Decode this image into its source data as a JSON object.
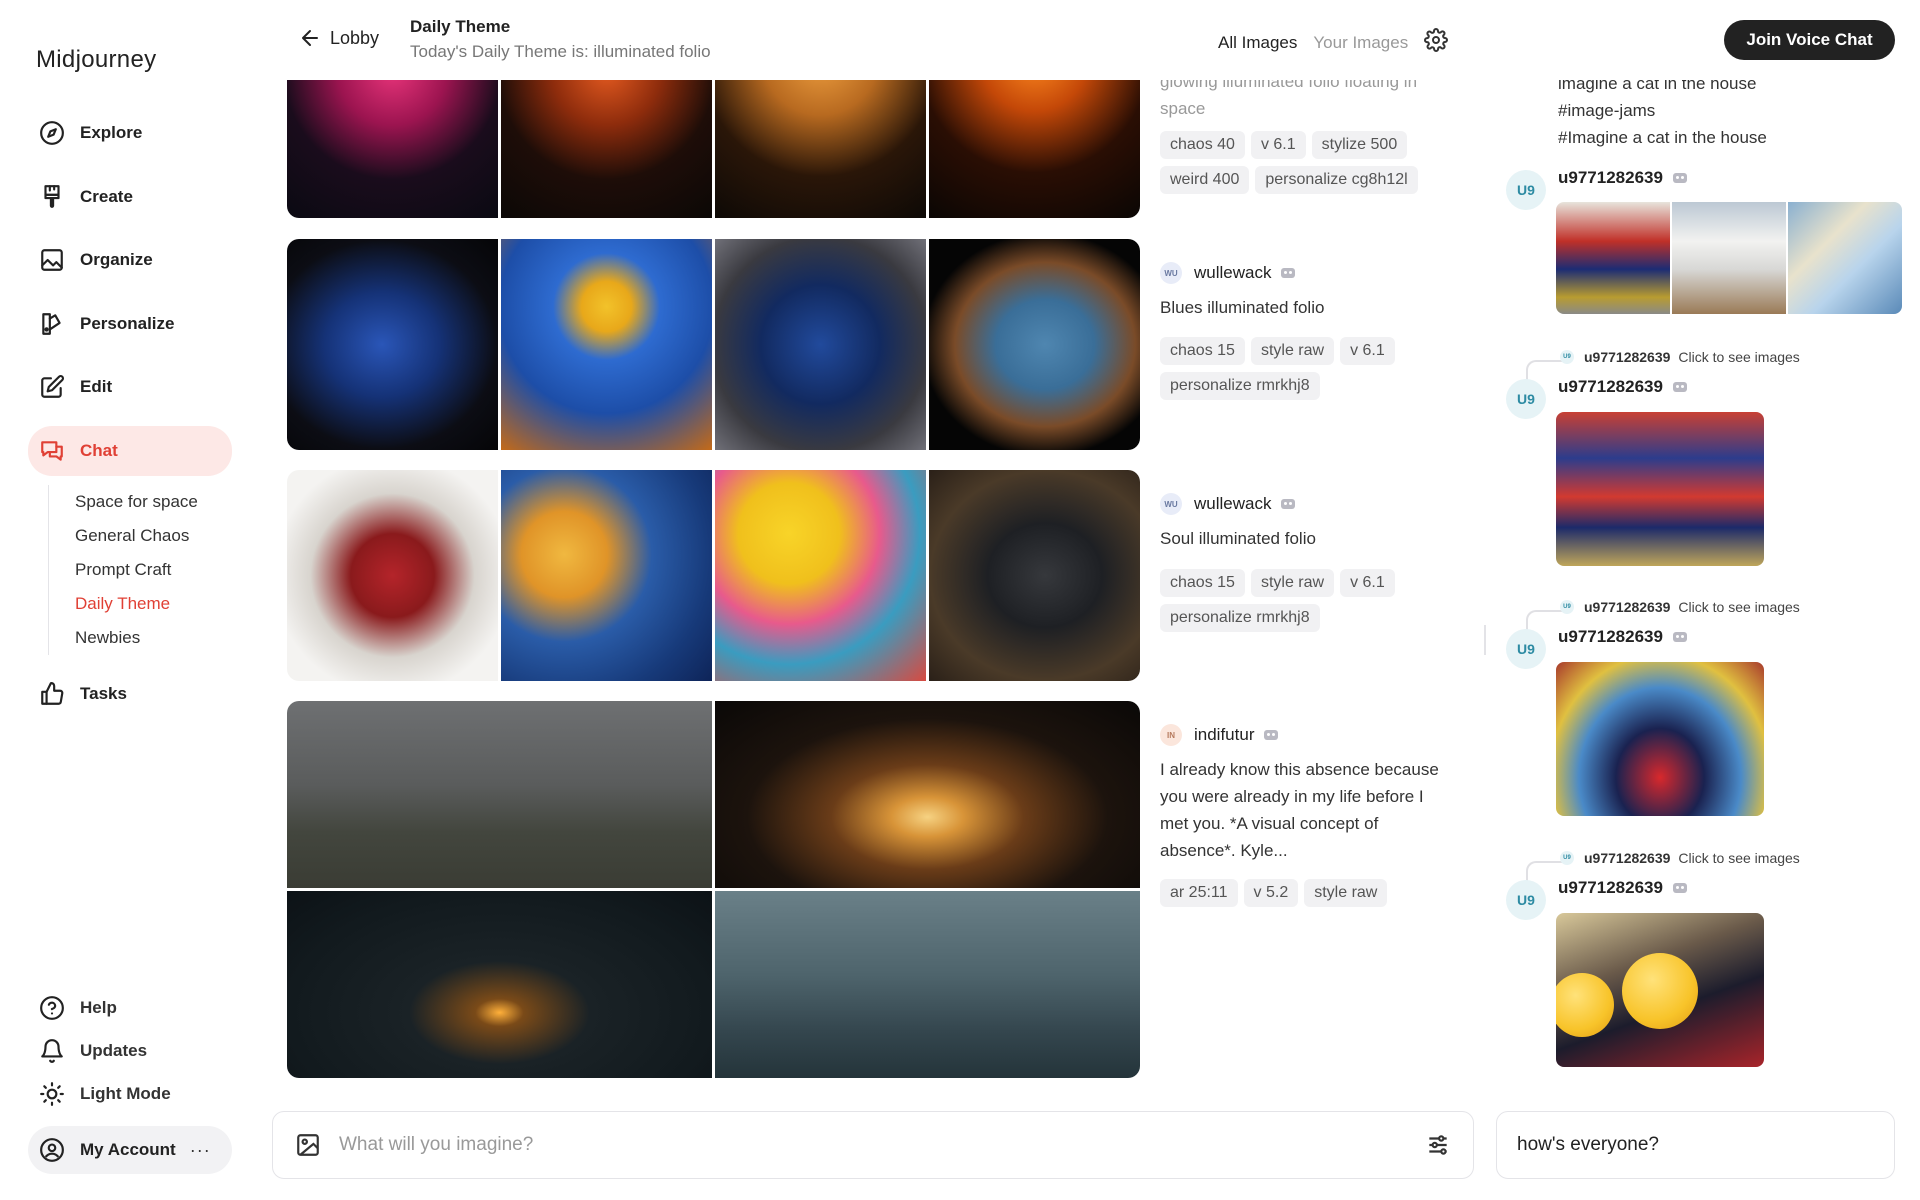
{
  "app": {
    "name": "Midjourney"
  },
  "sidebar": {
    "items": [
      {
        "label": "Explore",
        "icon": "compass-icon"
      },
      {
        "label": "Create",
        "icon": "brush-icon"
      },
      {
        "label": "Organize",
        "icon": "image-icon"
      },
      {
        "label": "Personalize",
        "icon": "palette-icon"
      },
      {
        "label": "Edit",
        "icon": "edit-icon"
      },
      {
        "label": "Chat",
        "icon": "chat-icon",
        "active": true
      },
      {
        "label": "Tasks",
        "icon": "thumbs-up-icon"
      }
    ],
    "chat_rooms": [
      "Space for space",
      "General Chaos",
      "Prompt Craft",
      "Daily Theme",
      "Newbies"
    ],
    "active_room": "Daily Theme",
    "bottom": [
      {
        "label": "Help",
        "icon": "help-icon"
      },
      {
        "label": "Updates",
        "icon": "bell-icon"
      },
      {
        "label": "Light Mode",
        "icon": "sun-icon"
      }
    ],
    "account": {
      "label": "My Account",
      "more": "···"
    }
  },
  "header": {
    "back_label": "Lobby",
    "title": "Daily Theme",
    "subtitle": "Today's Daily Theme is: illuminated folio",
    "tabs": {
      "all": "All Images",
      "yours": "Your Images"
    },
    "voice_button": "Join Voice Chat"
  },
  "feed": {
    "post1": {
      "prompt_visible": "glowing illuminated folio floating in space",
      "params": [
        "chaos 40",
        "v 6.1",
        "stylize 500",
        "weird 400",
        "personalize cg8h12l"
      ]
    },
    "post2": {
      "avatar": "WU",
      "user": "wullewack",
      "prompt": "Blues illuminated folio",
      "params": [
        "chaos 15",
        "style raw",
        "v 6.1",
        "personalize rmrkhj8"
      ]
    },
    "post3": {
      "avatar": "WU",
      "user": "wullewack",
      "prompt": "Soul illuminated folio",
      "params": [
        "chaos 15",
        "style raw",
        "v 6.1",
        "personalize rmrkhj8"
      ]
    },
    "post4": {
      "avatar": "IN",
      "user": "indifutur",
      "prompt": "I already know this absence because you were already in my life before I met you. *A visual concept of absence*. Kyle...",
      "params": [
        "ar 25:11",
        "v 5.2",
        "style raw"
      ]
    }
  },
  "chat": {
    "top_lines": [
      "imagine a cat in the house",
      "#image-jams",
      "#Imagine a cat in the house"
    ],
    "user": "u9771282639",
    "avatar": "U9",
    "reply_text": "Click to see images"
  },
  "inputs": {
    "imagine_placeholder": "What will you imagine?",
    "chat_value": "how's everyone?"
  },
  "colors": {
    "accent": "#e04035",
    "accent_bg": "#fde8e6",
    "dark_button": "#222222"
  }
}
